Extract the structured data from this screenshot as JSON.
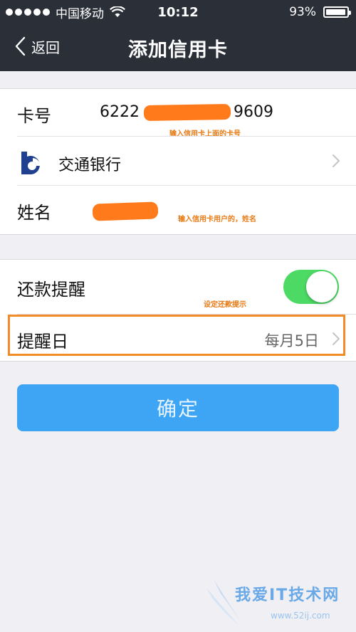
{
  "status_bar": {
    "carrier": "中国移动",
    "time": "10:12",
    "battery": "93%"
  },
  "nav": {
    "back_label": "返回",
    "title": "添加信用卡"
  },
  "form": {
    "card_label": "卡号",
    "card_number_start": "6222",
    "card_number_end": "9609",
    "card_annotation": "输入信用卡上面的卡号",
    "bank_name": "交通银行",
    "name_label": "姓名",
    "name_annotation": "输入信用卡用户的，姓名"
  },
  "reminder": {
    "label": "还款提醒",
    "enabled": true,
    "annotation": "设定还款提示",
    "day_label": "提醒日",
    "day_value": "每月5日"
  },
  "confirm_label": "确定",
  "watermark": {
    "text": "我爱IT技术网",
    "url": "www.52ij.com"
  },
  "colors": {
    "nav_bg": "#2b2f38",
    "toggle_on": "#4cd964",
    "button_bg": "#3da5f4",
    "annotation": "#e87a14",
    "highlight": "#f28c28"
  }
}
